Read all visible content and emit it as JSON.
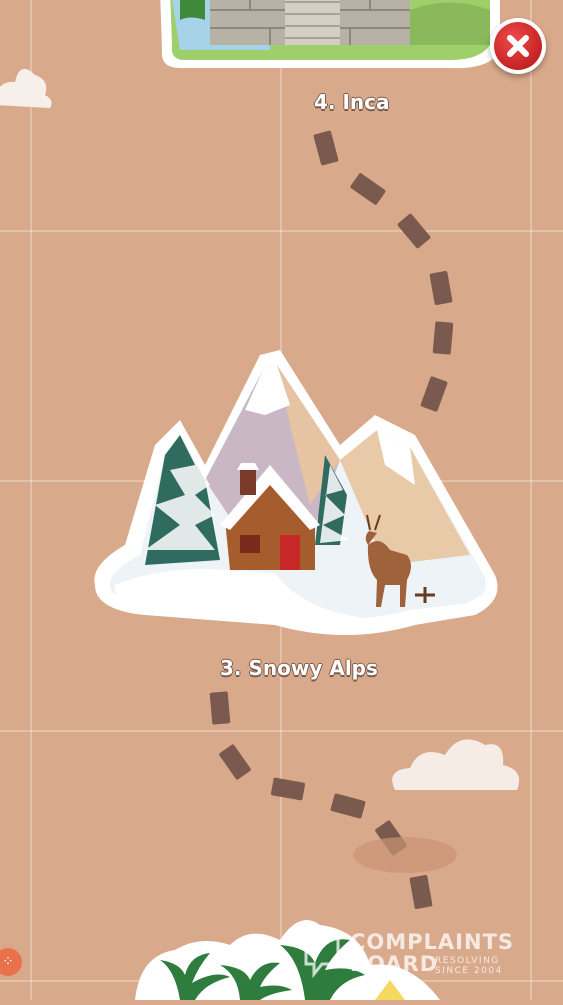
{
  "levels": [
    {
      "label": "4. Inca"
    },
    {
      "label": "3. Snowy Alps"
    }
  ],
  "close_button": {
    "icon": "close-icon"
  },
  "watermark": {
    "line1": "COMPLAINTS",
    "line2": "BOARD",
    "tag1": "RESOLVING",
    "tag2": "SINCE 2004"
  },
  "colors": {
    "background": "#d9a98b",
    "path": "#7a5a4e",
    "close_red": "#d32222"
  }
}
